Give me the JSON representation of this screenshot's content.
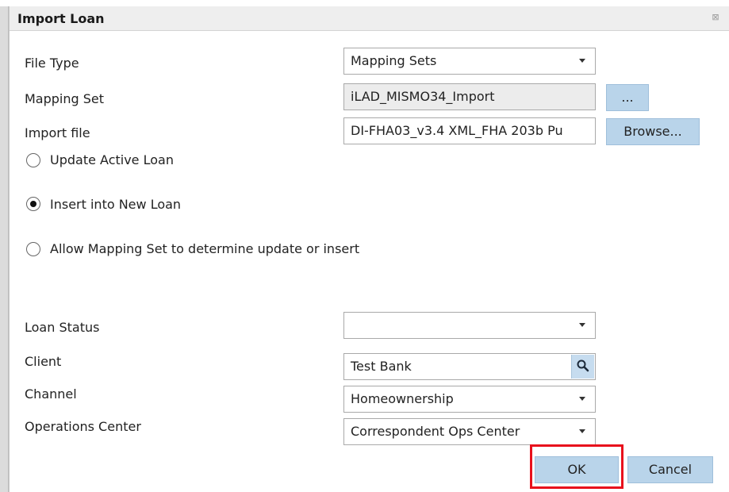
{
  "dialog": {
    "title": "Import Loan",
    "close_icon": "close-icon"
  },
  "file_type": {
    "label": "File Type",
    "value": "Mapping Sets"
  },
  "mapping_set": {
    "label": "Mapping Set",
    "value": "iLAD_MISMO34_Import",
    "button": "..."
  },
  "import_file": {
    "label": "Import file",
    "value": "DI-FHA03_v3.4 XML_FHA 203b Pu",
    "button": "Browse..."
  },
  "options": [
    {
      "label": "Update Active Loan",
      "selected": false
    },
    {
      "label": "Insert into New Loan",
      "selected": true
    },
    {
      "label": "Allow Mapping Set to determine update or insert",
      "selected": false
    }
  ],
  "loan_status": {
    "label": "Loan Status",
    "value": ""
  },
  "client": {
    "label": "Client",
    "value": "Test Bank",
    "icon": "search-icon"
  },
  "channel": {
    "label": "Channel",
    "value": "Homeownership"
  },
  "operations_center": {
    "label": "Operations Center",
    "value": "Correspondent Ops Center"
  },
  "buttons": {
    "ok": "OK",
    "cancel": "Cancel"
  },
  "colors": {
    "button_bg": "#b9d4ea",
    "highlight": "#e8101c",
    "title_bg": "#eeeeee"
  }
}
